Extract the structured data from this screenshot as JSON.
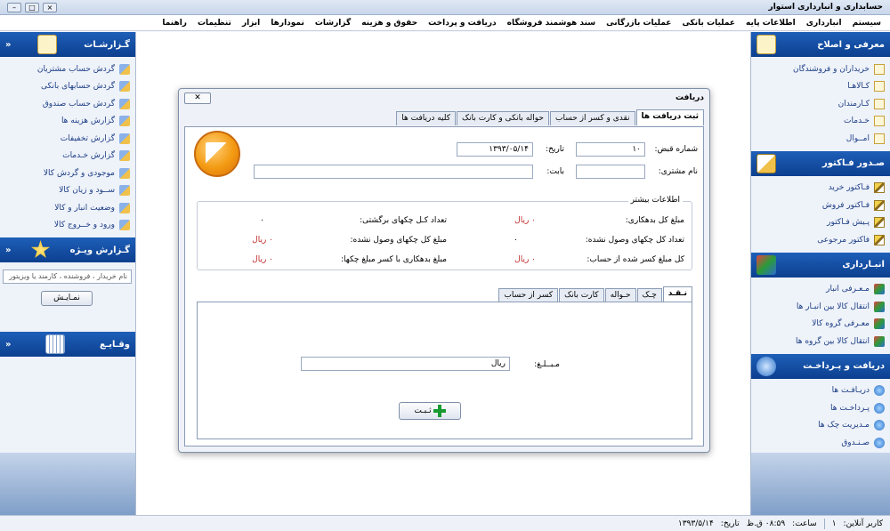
{
  "window": {
    "title": "حسابداری و انبارداری استوار"
  },
  "menu": [
    "سیستم",
    "انبارداری",
    "اطلاعات پایه",
    "عملیات بانکی",
    "عملیات بازرگانی",
    "سند هوشمند فروشگاه",
    "دریافت و پرداخت",
    "حقوق و هزینه",
    "گزارشات",
    "نمودارها",
    "ابزار",
    "تنظیمات",
    "راهنما"
  ],
  "right_sidebar": {
    "sections": [
      {
        "title": "معرفی و اصلاح",
        "items": [
          "خریداران و فروشندگان",
          "کـالاهـا",
          "کـارمندان",
          "خـدمات",
          "امــوال"
        ]
      },
      {
        "title": "صـدور فـاکتور",
        "items": [
          "فـاکتور خرید",
          "فـاکتور فروش",
          "پـیش فـاکتور",
          "فاکتور مرجوعی"
        ]
      },
      {
        "title": "انبـارداری",
        "items": [
          "مـعـرفی انبار",
          "انتقال کالا بین انبـار ها",
          "معـرفی گروه کالا",
          "انتقال کالا بین گروه ها"
        ]
      },
      {
        "title": "دریافت و پـرداخـت",
        "items": [
          "دریـافـت ها",
          "پـرداخـت ها",
          "مـدیریت چک ها",
          "صـنـدوق"
        ]
      }
    ]
  },
  "left_sidebar": {
    "reports": {
      "title": "گـزارشـات",
      "items": [
        "گردش حساب مشتریان",
        "گردش حسابهای بانکی",
        "گردش حساب صندوق",
        "گزارش هزینه ها",
        "گزارش تخفیفات",
        "گزارش خـدمات",
        "موجودی و گردش کالا",
        "ســود و زیان کالا",
        "وضعیت انبار و کالا",
        "ورود و خــروج کالا"
      ]
    },
    "special": {
      "title": "گـزارش ویـژه",
      "search_value": "نام خریدار ، فروشنده ، کارمند یا ویزیتور",
      "show_button": "نمـایـش"
    },
    "events": {
      "title": "وقـایـع"
    }
  },
  "dialog": {
    "title": "دریافت",
    "tabs": [
      "ثبت دریافت ها",
      "نقدی و کسر از حساب",
      "حواله بانکی و کارت بانک",
      "کلیه دریافت ها"
    ],
    "receipt_no_label": "شماره قبض:",
    "receipt_no": "۱۰",
    "date_label": "تاریخ:",
    "date": "۱۳۹۳/۰۵/۱۴",
    "customer_label": "نام مشتری:",
    "customer": "",
    "for_label": "بابت:",
    "for_value": "",
    "more_info": {
      "title": "اطلاعات بیشتر",
      "rows": [
        {
          "label_r": "مبلغ کل بدهکاری:",
          "value_r": "۰ ریال",
          "label_l": "تعداد کـل چکهای برگشتی:",
          "value_l": "۰"
        },
        {
          "label_r": "تعداد کل چکهای وصول نشده:",
          "value_r": "۰",
          "label_l": "مبلغ کل چکهای وصول نشده:",
          "value_l": "۰ ریال"
        },
        {
          "label_r": "کل مبلغ کسر شده از حساب:",
          "value_r": "۰ ریال",
          "label_l": "مبلغ بدهکاری با کسر مبلغ چکها:",
          "value_l": "۰ ریال"
        }
      ]
    },
    "inner_tabs": [
      "نـقـد",
      "چـک",
      "حـواله",
      "کارت بانک",
      "کسر از حساب"
    ],
    "amount_label": "مـبــلـغ:",
    "amount_unit": "ریال",
    "submit_button": "ثـبـت"
  },
  "status": {
    "user_label": "کاربر آنلاین:",
    "user": "۱",
    "time_label": "ساعت:",
    "time": "۰۸:۵۹ ق.ظ",
    "date_label": "تاریخ:",
    "date": "۱۳۹۳/۵/۱۴"
  }
}
